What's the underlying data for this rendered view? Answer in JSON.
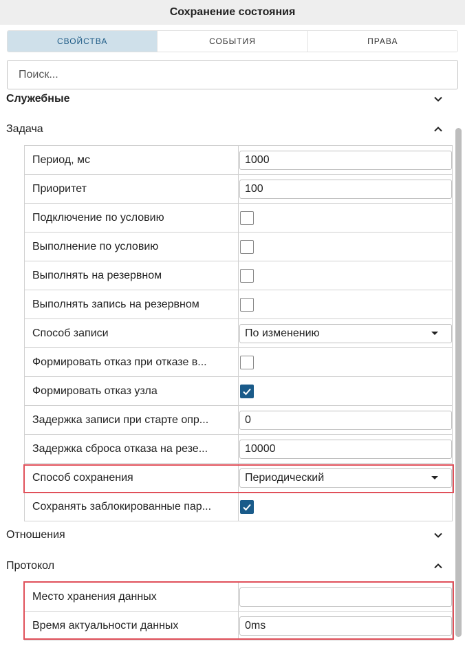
{
  "window": {
    "title": "Сохранение состояния"
  },
  "tabs": [
    {
      "label": "СВОЙСТВА",
      "active": true
    },
    {
      "label": "СОБЫТИЯ",
      "active": false
    },
    {
      "label": "ПРАВА",
      "active": false
    }
  ],
  "search": {
    "placeholder": "Поиск..."
  },
  "sections": {
    "service": {
      "label": "Служебные",
      "expanded": false
    },
    "task": {
      "label": "Задача",
      "expanded": true
    },
    "relations": {
      "label": "Отношения",
      "expanded": false
    },
    "protocol": {
      "label": "Протокол",
      "expanded": true
    }
  },
  "task_rows": [
    {
      "label": "Период, мс",
      "type": "input",
      "value": "1000"
    },
    {
      "label": "Приоритет",
      "type": "input",
      "value": "100"
    },
    {
      "label": "Подключение по условию",
      "type": "checkbox",
      "checked": false
    },
    {
      "label": "Выполнение по условию",
      "type": "checkbox",
      "checked": false
    },
    {
      "label": "Выполнять на резервном",
      "type": "checkbox",
      "checked": false
    },
    {
      "label": "Выполнять запись на резервном",
      "type": "checkbox",
      "checked": false
    },
    {
      "label": "Способ записи",
      "type": "select",
      "value": "По изменению"
    },
    {
      "label": "Формировать отказ при отказе в...",
      "type": "checkbox",
      "checked": false
    },
    {
      "label": "Формировать отказ узла",
      "type": "checkbox",
      "checked": true
    },
    {
      "label": "Задержка записи при старте опр...",
      "type": "input",
      "value": "0"
    },
    {
      "label": "Задержка сброса отказа на резе...",
      "type": "input",
      "value": "10000"
    },
    {
      "label": "Способ сохранения",
      "type": "select",
      "value": "Периодический"
    },
    {
      "label": "Сохранять заблокированные пар...",
      "type": "checkbox",
      "checked": true
    }
  ],
  "protocol_rows": [
    {
      "label": "Место хранения данных",
      "type": "input",
      "value": ""
    },
    {
      "label": "Время актуальности данных",
      "type": "input",
      "value": "0ms"
    }
  ],
  "colors": {
    "accent": "#1a5b8a",
    "highlight": "#e0505a",
    "active_tab_bg": "#cfe0ea"
  }
}
